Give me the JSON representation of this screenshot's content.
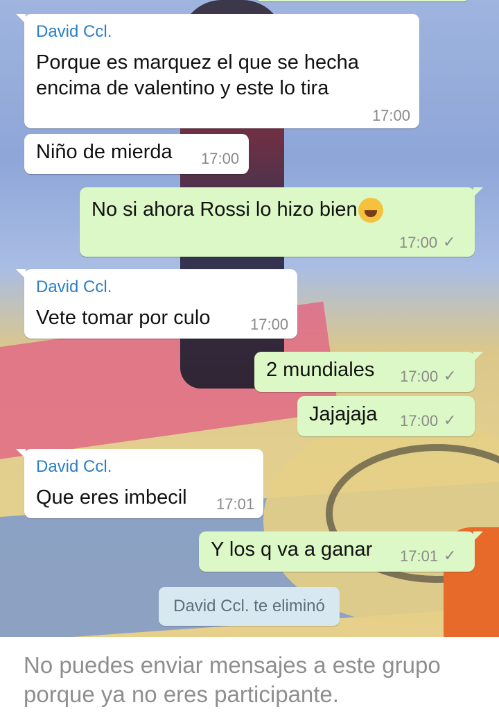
{
  "messages": [
    {
      "direction": "in",
      "sender": "David Ccl.",
      "lines": [
        "Porque es marquez el que se hecha",
        "encima de valentino y este lo tira"
      ],
      "time": "17:00"
    },
    {
      "direction": "in",
      "text": "Niño de mierda",
      "time": "17:00"
    },
    {
      "direction": "out",
      "text": "No si ahora Rossi lo hizo bien",
      "emoji": "face-with-tears-of-joy",
      "time": "17:00",
      "check": "✓"
    },
    {
      "direction": "in",
      "sender": "David Ccl.",
      "text": "Vete  tomar por culo",
      "time": "17:00"
    },
    {
      "direction": "out",
      "text": "2 mundiales",
      "time": "17:00",
      "check": "✓"
    },
    {
      "direction": "out",
      "text": "Jajajaja",
      "time": "17:00",
      "check": "✓"
    },
    {
      "direction": "in",
      "sender": "David Ccl.",
      "text": "Que eres imbecil",
      "time": "17:01"
    },
    {
      "direction": "out",
      "text": "Y los q va a ganar",
      "time": "17:01",
      "check": "✓"
    }
  ],
  "system_message": "David Ccl. te eliminó",
  "footer": {
    "notice": "No puedes enviar mensajes a este grupo porque ya no eres participante."
  },
  "colors": {
    "incoming": "#ffffff",
    "outgoing": "#dcf8c6",
    "sender_name": "#2b7ec9",
    "system_bg": "#d7e8f1"
  }
}
